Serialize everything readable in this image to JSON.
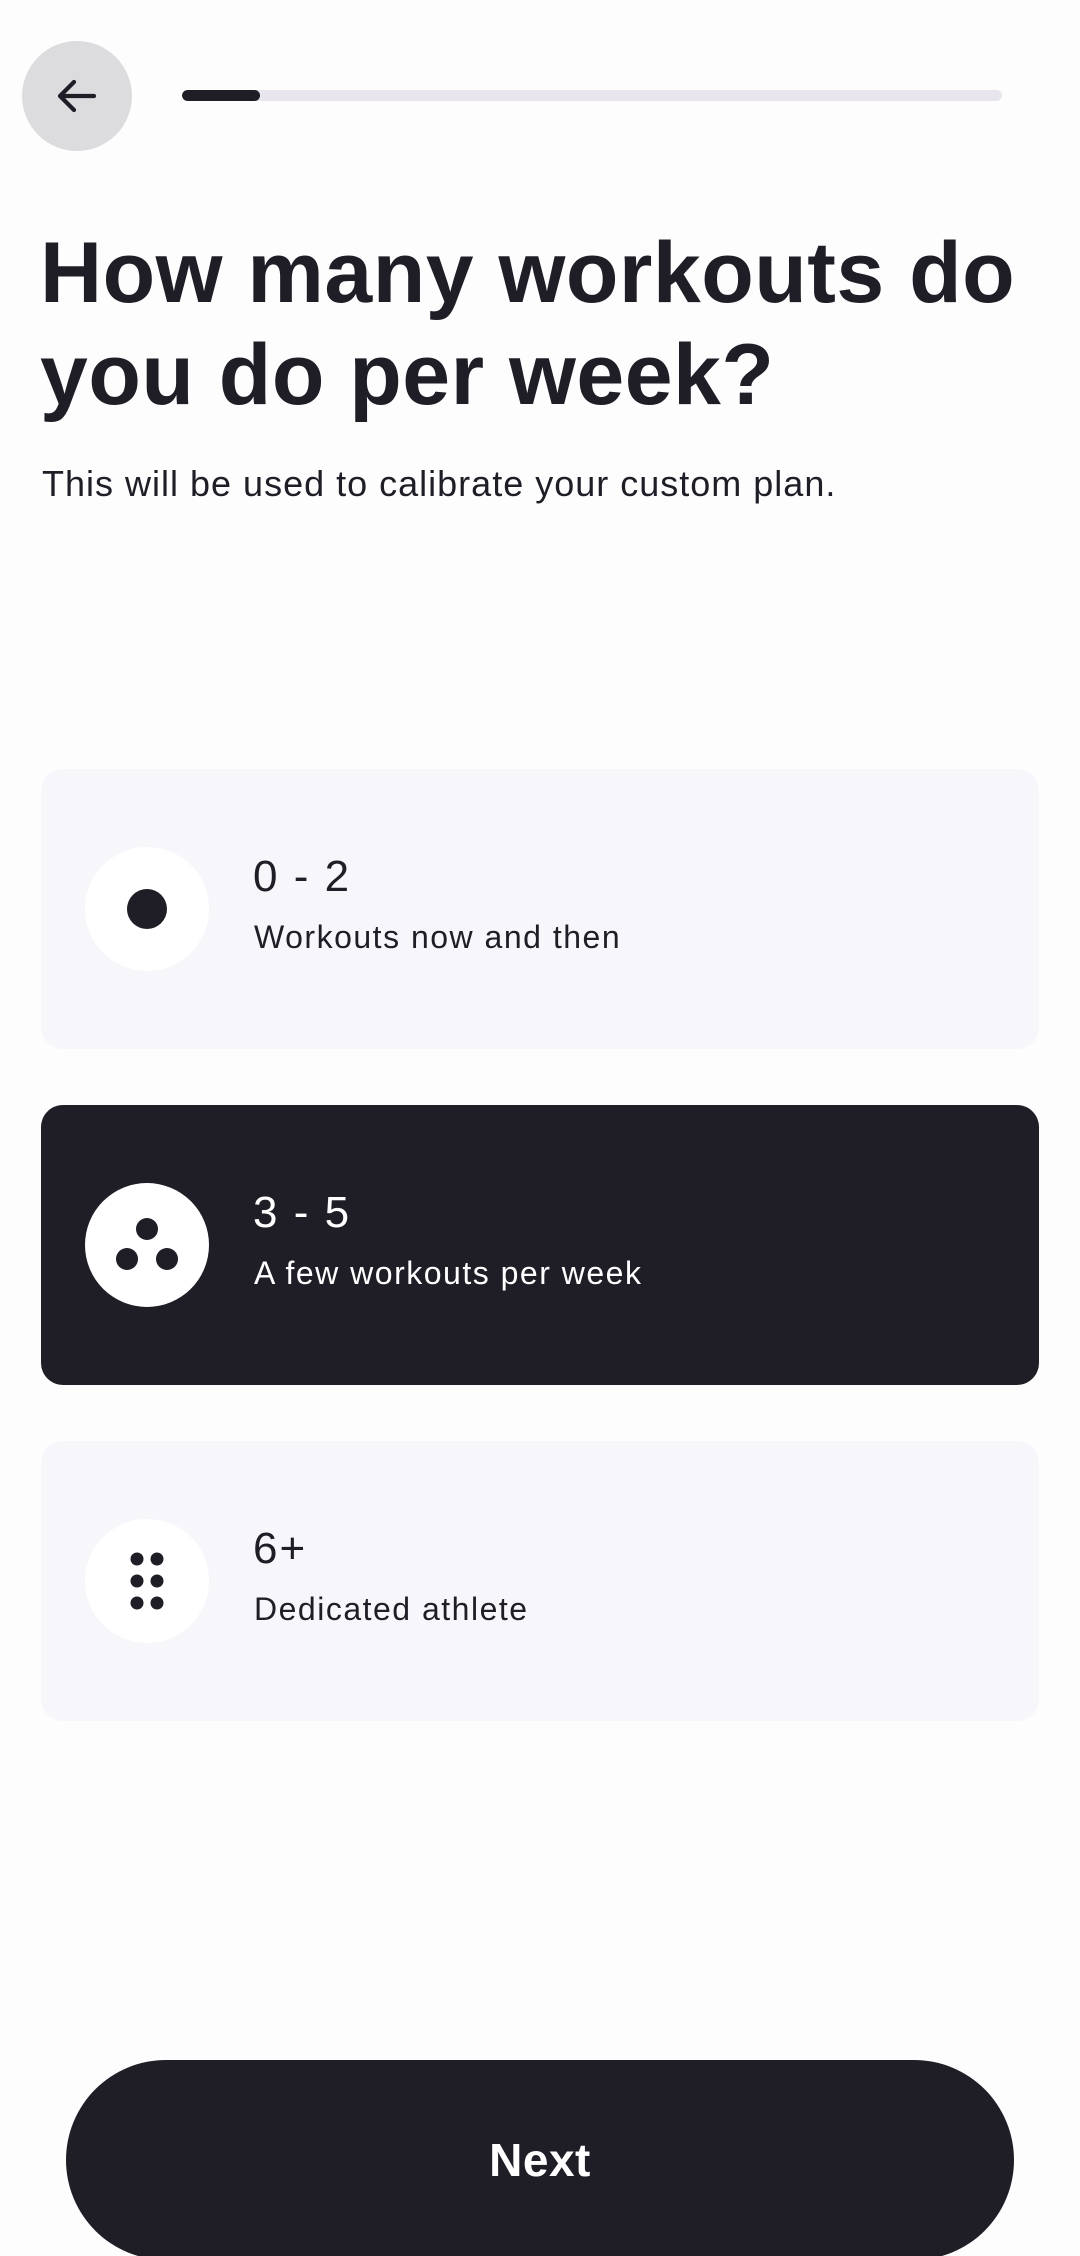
{
  "header": {
    "back_icon": "arrow-left-icon",
    "progress": 0.095
  },
  "title": "How many workouts do you do per week?",
  "subtitle": "This will be used to calibrate your custom plan.",
  "options": [
    {
      "label": "0 - 2",
      "description": "Workouts now and then",
      "icon": "single-dot-icon",
      "selected": false
    },
    {
      "label": "3 - 5",
      "description": "A few workouts per week",
      "icon": "three-dots-icon",
      "selected": true
    },
    {
      "label": "6+",
      "description": "Dedicated athlete",
      "icon": "six-dots-icon",
      "selected": false
    }
  ],
  "next_label": "Next",
  "colors": {
    "primary": "#1f1d26",
    "card": "#f7f7fb",
    "progress_track": "#e8e5ee",
    "back_bg": "#dcdcdf"
  }
}
